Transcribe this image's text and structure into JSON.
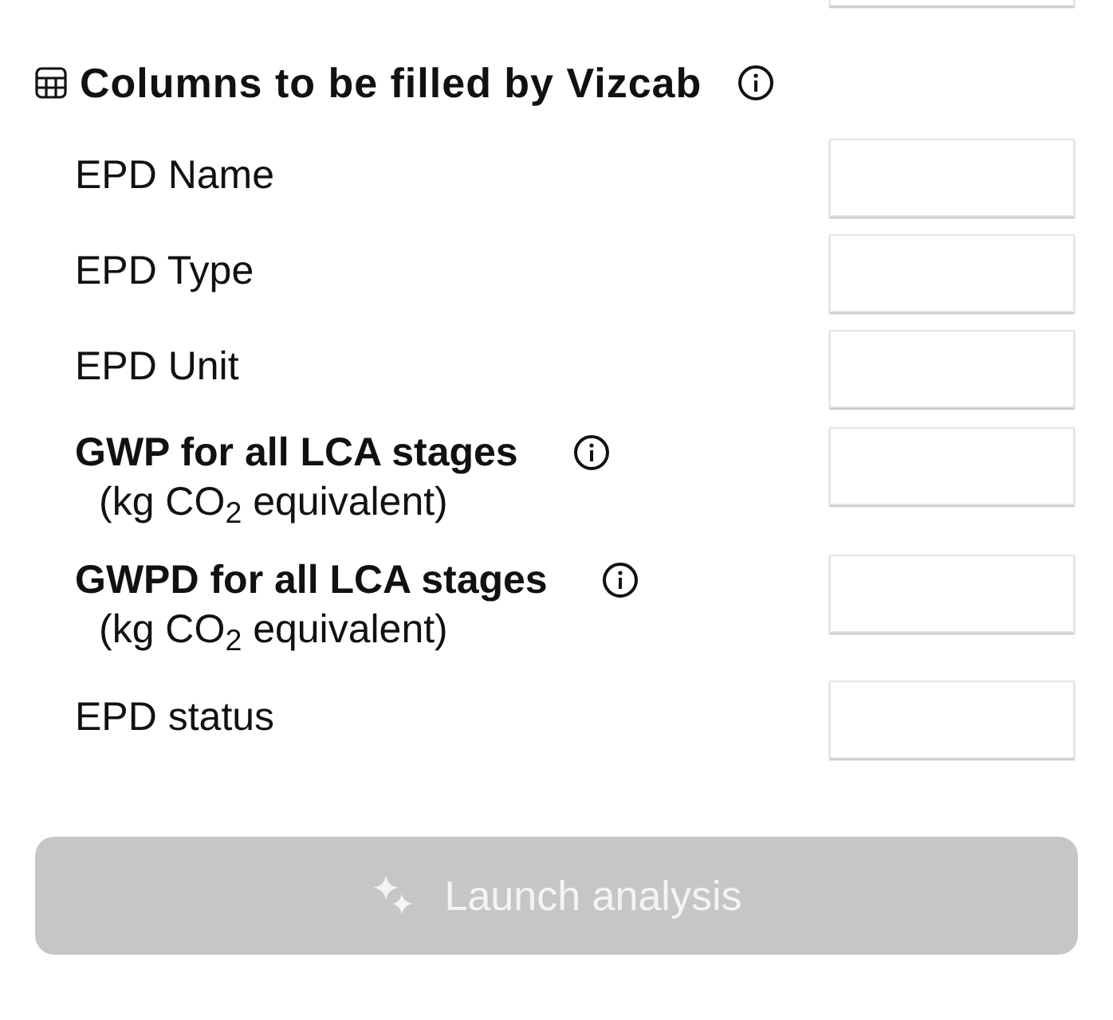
{
  "section": {
    "title": "Columns to be filled by Vizcab"
  },
  "rows": [
    {
      "kind": "plain",
      "label": "EPD Name"
    },
    {
      "kind": "plain",
      "label": "EPD Type"
    },
    {
      "kind": "plain",
      "label": "EPD Unit"
    },
    {
      "kind": "metric",
      "label": "GWP for all LCA stages",
      "unit": "(kg CO$_{2}$ equivalent)"
    },
    {
      "kind": "metric",
      "label": "GWPD for all LCA stages",
      "unit": "(kg CO$_{2}$ equivalent)"
    },
    {
      "kind": "plain",
      "label": "EPD status"
    }
  ],
  "button": {
    "label": "Launch analysis",
    "disabled": true
  }
}
